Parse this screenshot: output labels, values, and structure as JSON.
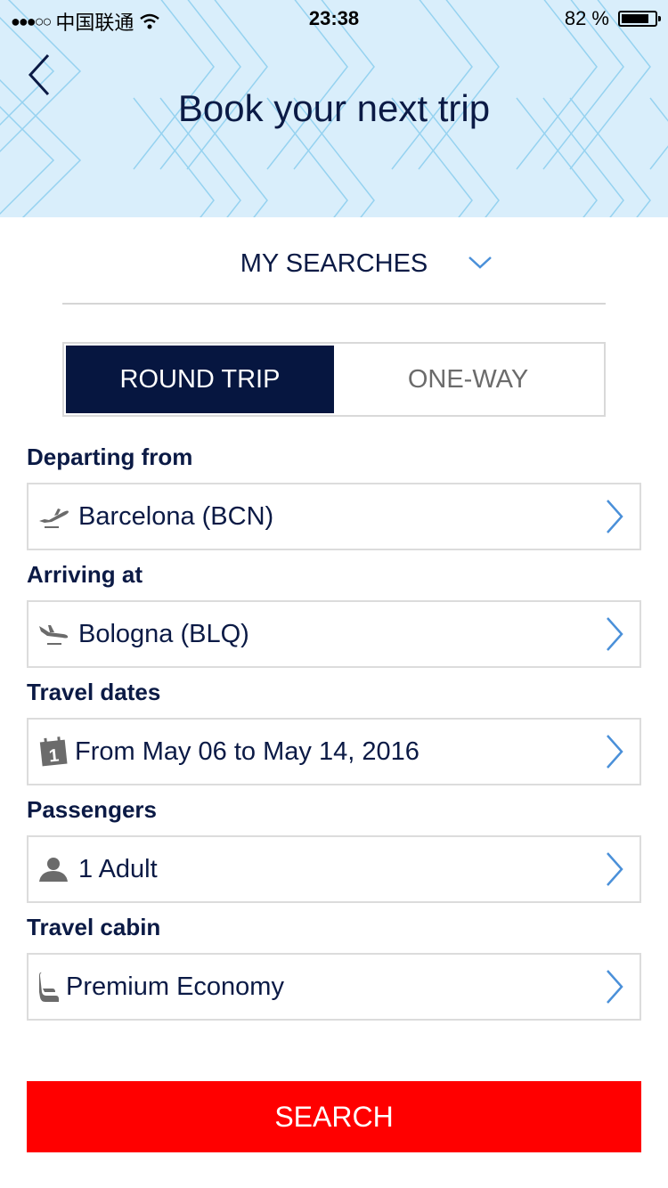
{
  "status_bar": {
    "carrier": "中国联通",
    "time": "23:38",
    "battery": "82 %",
    "battery_level": 0.82
  },
  "header": {
    "title": "Book your next trip"
  },
  "searches": {
    "label": "MY SEARCHES"
  },
  "trip_type": {
    "options": [
      {
        "label": "ROUND TRIP",
        "selected": true
      },
      {
        "label": "ONE-WAY",
        "selected": false
      }
    ]
  },
  "fields": {
    "departing": {
      "label": "Departing from",
      "value": "Barcelona (BCN)",
      "icon": "takeoff-icon"
    },
    "arriving": {
      "label": "Arriving at",
      "value": "Bologna (BLQ)",
      "icon": "landing-icon"
    },
    "dates": {
      "label": "Travel dates",
      "value": "From May 06 to May 14, 2016",
      "icon": "calendar-icon",
      "icon_text": "1"
    },
    "passengers": {
      "label": "Passengers",
      "value": "1 Adult",
      "icon": "person-icon"
    },
    "cabin": {
      "label": "Travel cabin",
      "value": "Premium Economy",
      "icon": "seat-icon"
    }
  },
  "search_button": {
    "label": "SEARCH"
  },
  "colors": {
    "header_bg": "#d9eefb",
    "primary_navy": "#061640",
    "search_red": "#ff0000",
    "chevron_blue": "#4a90d9"
  }
}
